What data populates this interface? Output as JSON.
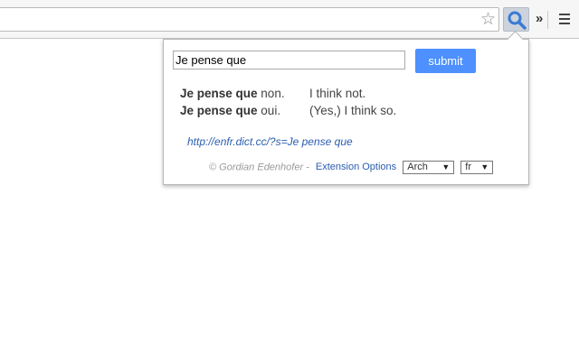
{
  "toolbar": {
    "omnibox_value": "",
    "star_icon": "star-icon",
    "extension_icon": "magnifier-icon",
    "overflow_label": "»",
    "menu_icon": "hamburger-icon"
  },
  "popup": {
    "query_value": "Je pense que",
    "submit_label": "submit",
    "results": [
      {
        "term": "Je pense que",
        "rest": " non.",
        "translation": "I think not."
      },
      {
        "term": "Je pense que",
        "rest": " oui.",
        "translation": "(Yes,) I think so."
      }
    ],
    "dict_link": "http://enfr.dict.cc/?s=Je pense que",
    "footer": {
      "copyright": "© Gordian Edenhofer - ",
      "options_link": "Extension Options",
      "select1_value": "Arch",
      "select2_value": "fr"
    }
  },
  "colors": {
    "accent": "#4d90fe",
    "link": "#2a5db0"
  }
}
